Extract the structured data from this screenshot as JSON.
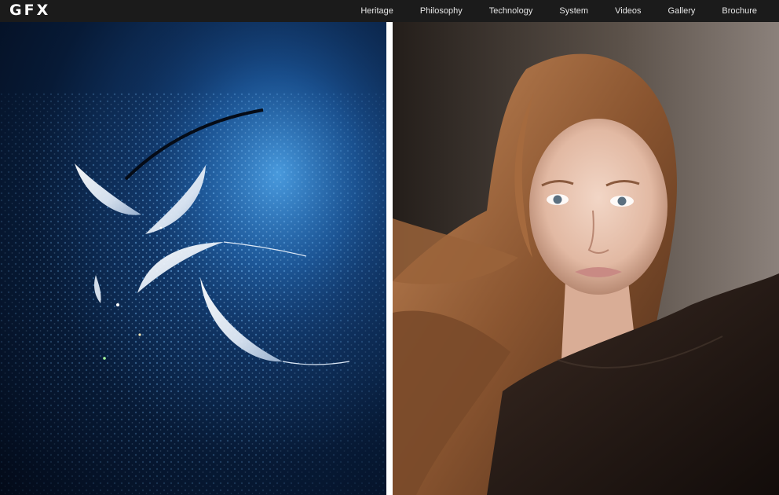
{
  "header": {
    "logo_text": "GFX",
    "nav": [
      {
        "label": "Heritage"
      },
      {
        "label": "Philosophy"
      },
      {
        "label": "Technology"
      },
      {
        "label": "System"
      },
      {
        "label": "Videos"
      },
      {
        "label": "Gallery"
      },
      {
        "label": "Brochure"
      }
    ]
  },
  "gallery": {
    "left_image": {
      "icon": "feathers-on-water-droplets-photo"
    },
    "right_image": {
      "icon": "portrait-woman-photo"
    }
  },
  "colors": {
    "topbar": "#1b1b1b",
    "nav_text": "#e6e6e6",
    "gutter": "#ffffff"
  }
}
